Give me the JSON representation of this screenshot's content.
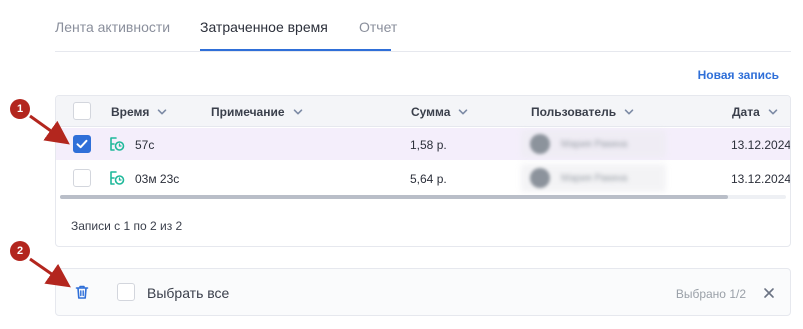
{
  "tabs": [
    {
      "label": "Лента активности",
      "active": false
    },
    {
      "label": "Затраченное время",
      "active": true
    },
    {
      "label": "Отчет",
      "active": false
    }
  ],
  "new_record_label": "Новая запись",
  "table": {
    "columns": [
      "Время",
      "Примечание",
      "Сумма",
      "Пользователь",
      "Дата"
    ],
    "rows": [
      {
        "selected": true,
        "time": "57с",
        "note": "",
        "amount": "1,58 р.",
        "user": "Мария Ракина",
        "date": "13.12.2024"
      },
      {
        "selected": false,
        "time": "03м 23с",
        "note": "",
        "amount": "5,64 р.",
        "user": "Мария Ракина",
        "date": "13.12.2024"
      }
    ]
  },
  "records_info": "Записи с 1 по 2 из 2",
  "bulk_bar": {
    "select_all_label": "Выбрать все",
    "selected_count": "Выбрано 1/2"
  },
  "annotations": [
    "1",
    "2"
  ],
  "colors": {
    "accent": "#2f6fd8",
    "timer_icon": "#1fb89a",
    "selected_row": "#f4eefb",
    "annotation": "#b3261e"
  }
}
